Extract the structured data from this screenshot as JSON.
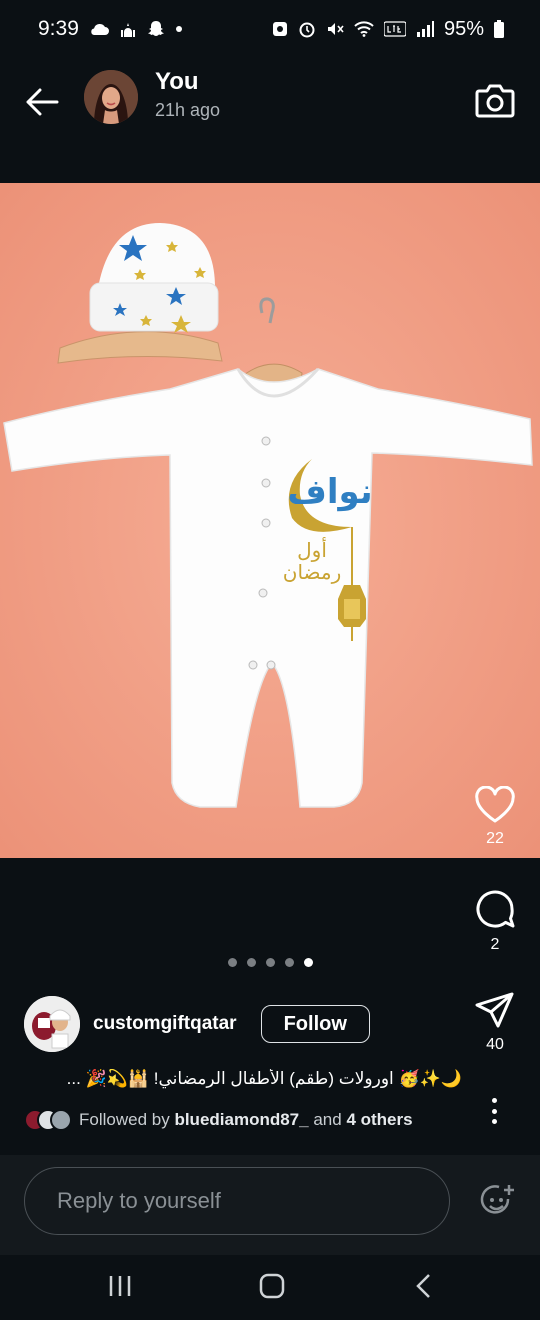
{
  "status_bar": {
    "time": "9:39",
    "battery": "95%"
  },
  "header": {
    "username": "You",
    "time_ago": "21h ago"
  },
  "story": {
    "image_alt_text": [
      "نواف",
      "أول",
      "رمضان"
    ],
    "slide_count": 5,
    "active_slide": 5
  },
  "actions": {
    "likes": "22",
    "comments": "2",
    "shares": "40"
  },
  "post": {
    "author": "customgiftqatar",
    "follow_label": "Follow",
    "caption": "🌙✨🥳 اورولات (طقم) الأطفال الرمضاني! 🕌💫🎉 ...",
    "followed_prefix": "Followed by",
    "followed_user": "bluediamond87_",
    "followed_and": "and",
    "followed_others": "4 others"
  },
  "reply": {
    "placeholder": "Reply to yourself"
  },
  "colors": {
    "background": "#0b1014",
    "story_bg": "#f29e85",
    "gold": "#c9a332",
    "blue": "#2f7fc2"
  }
}
